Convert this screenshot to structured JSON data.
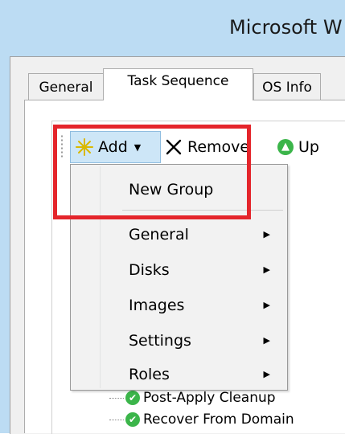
{
  "window": {
    "title": "Microsoft W"
  },
  "tabs": [
    {
      "label": "General"
    },
    {
      "label": "Task Sequence"
    },
    {
      "label": "OS Info"
    }
  ],
  "toolbar": {
    "add_label": "Add",
    "remove_label": "Remove",
    "up_label": "Up"
  },
  "add_menu": {
    "items": [
      {
        "label": "New Group"
      },
      {
        "label": "General"
      },
      {
        "label": "Disks"
      },
      {
        "label": "Images"
      },
      {
        "label": "Settings"
      },
      {
        "label": "Roles"
      }
    ]
  },
  "tree": {
    "items": [
      {
        "label": "Post-Apply Cleanup"
      },
      {
        "label": "Recover From Domain"
      }
    ]
  },
  "colors": {
    "titlebar": "#bcdcf3",
    "highlight": "#e4252b",
    "add_hover": "#cde6f7",
    "success": "#3bb54a"
  }
}
